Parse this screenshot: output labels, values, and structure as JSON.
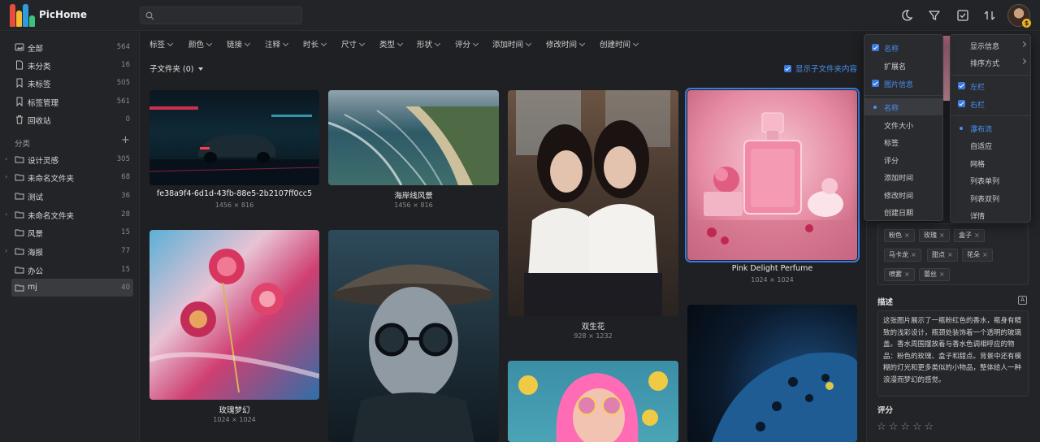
{
  "app": {
    "name": "PicHome"
  },
  "search": {
    "placeholder": ""
  },
  "sidebar": {
    "items": [
      {
        "label": "全部",
        "count": "564",
        "icon": "photo-icon"
      },
      {
        "label": "未分类",
        "count": "16",
        "icon": "file-icon"
      },
      {
        "label": "未标签",
        "count": "505",
        "icon": "tag-icon"
      },
      {
        "label": "标签管理",
        "count": "561",
        "icon": "bookmark-icon"
      },
      {
        "label": "回收站",
        "count": "0",
        "icon": "trash-icon"
      }
    ],
    "section_label": "分类",
    "folders": [
      {
        "label": "设计灵感",
        "count": "305",
        "expandable": true
      },
      {
        "label": "未命名文件夹",
        "count": "68",
        "expandable": true
      },
      {
        "label": "测试",
        "count": "36",
        "expandable": false
      },
      {
        "label": "未命名文件夹",
        "count": "28",
        "expandable": true
      },
      {
        "label": "风景",
        "count": "15",
        "expandable": false
      },
      {
        "label": "海报",
        "count": "77",
        "expandable": true
      },
      {
        "label": "办公",
        "count": "15",
        "expandable": false
      },
      {
        "label": "mj",
        "count": "40",
        "expandable": false,
        "active": true
      }
    ]
  },
  "filters": [
    "标签",
    "颜色",
    "链接",
    "注释",
    "时长",
    "尺寸",
    "类型",
    "形状",
    "评分",
    "添加时间",
    "修改时间",
    "创建时间"
  ],
  "subfolder": {
    "label": "子文件夹 (0)"
  },
  "show_subfolder_label": "显示子文件夹内容",
  "cards": [
    {
      "title": "fe38a9f4-6d1d-43fb-88e5-2b2107ff0cc5",
      "dim": "1456 × 816"
    },
    {
      "title": "海岸线风景",
      "dim": "1456 × 816"
    },
    {
      "title": "双生花",
      "dim": "928 × 1232"
    },
    {
      "title": "Pink Delight Perfume",
      "dim": "1024 × 1024"
    },
    {
      "title": "玫瑰梦幻",
      "dim": "1024 × 1024"
    }
  ],
  "right_panel": {
    "tags": [
      "粉色",
      "玫瑰",
      "盒子",
      "马卡龙",
      "甜点",
      "花朵",
      "喷雾",
      "蕾丝"
    ],
    "description_label": "描述",
    "description": "这张图片展示了一瓶粉红色的香水，瓶身有精致的浅彩设计，瓶颈处装饰着一个透明的玻璃盖。香水周围摆放着与香水色调相呼应的物品：粉色的玫瑰、盒子和甜点。背景中还有模糊的灯光和更多类似的小物品，整体给人一种浪漫而梦幻的感觉。",
    "rating_label": "评分",
    "stars": "☆☆☆☆☆"
  },
  "menu_fields": {
    "checks": [
      {
        "label": "名称",
        "checked": true
      },
      {
        "label": "扩展名",
        "checked": false
      },
      {
        "label": "图片信息",
        "checked": true
      }
    ],
    "sort": [
      {
        "label": "名称",
        "on": true
      },
      {
        "label": "文件大小",
        "on": false
      },
      {
        "label": "标签",
        "on": false
      },
      {
        "label": "评分",
        "on": false
      },
      {
        "label": "添加时间",
        "on": false
      },
      {
        "label": "修改时间",
        "on": false
      },
      {
        "label": "创建日期",
        "on": false
      }
    ]
  },
  "menu_view": {
    "top": [
      {
        "label": "显示信息"
      },
      {
        "label": "排序方式"
      }
    ],
    "panels": [
      {
        "label": "左栏",
        "checked": true
      },
      {
        "label": "右栏",
        "checked": true
      }
    ],
    "layouts": [
      {
        "label": "瀑布流",
        "on": true
      },
      {
        "label": "自适应",
        "on": false
      },
      {
        "label": "网格",
        "on": false
      },
      {
        "label": "列表单列",
        "on": false
      },
      {
        "label": "列表双列",
        "on": false
      },
      {
        "label": "详情",
        "on": false
      }
    ]
  },
  "colors": {
    "accent": "#3a7be0",
    "bg": "#1f2023",
    "panel": "#232428"
  }
}
